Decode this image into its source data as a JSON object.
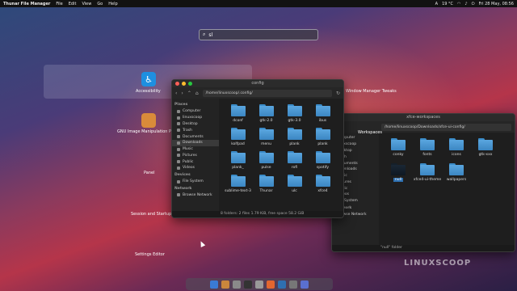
{
  "topbar": {
    "app": "Thunar File Manager",
    "menu": [
      "File",
      "Edit",
      "View",
      "Go",
      "Help"
    ],
    "status": [
      "A",
      "19 °C",
      "Fri 28 May, 08:56"
    ]
  },
  "search": {
    "value": "sl",
    "icon": "search-icon"
  },
  "launcher": {
    "items": [
      "Accessibility",
      "Window Manager Tweaks",
      "GNU Image Manipulation Program",
      "Panel",
      "Session and Startup",
      "Settings Editor"
    ]
  },
  "win1": {
    "title": "config",
    "path": "/home/linuxscoop/.config/",
    "sidebar": {
      "places_title": "Places",
      "places": [
        "Computer",
        "linuxscoop",
        "Desktop",
        "Trash",
        "Documents",
        "Downloads",
        "Music",
        "Pictures",
        "Public",
        "Videos"
      ],
      "devices_title": "Devices",
      "devices": [
        "File System"
      ],
      "network_title": "Network",
      "network": [
        "Browse Network"
      ]
    },
    "folders": [
      "dconf",
      "gtk-2.0",
      "gtk-3.0",
      "ibus",
      "kolfpad",
      "menu",
      "plank",
      "plank",
      "plank_",
      "pulse",
      "rofi",
      "spotify",
      "sublime-text-3",
      "Thunar",
      "ulc",
      "xfce4"
    ],
    "status": "8 folders: 2 files 1.79 KiB, free space 58.2 GiB"
  },
  "win2": {
    "title": "xfce-workspaces",
    "path": "/home/linuxscoop/Downloads/xfce-ui-config/",
    "sidebar": [
      "Computer",
      "linuxscoop",
      "Desktop",
      "Trash",
      "Documents",
      "Downloads",
      "Music",
      "Pictures",
      "Public",
      "Videos"
    ],
    "devices": [
      "File System"
    ],
    "network_title": "Network",
    "network": [
      "Browse Network"
    ],
    "folders": [
      "conky",
      "fonts",
      "icons",
      "gtk-xxx",
      "null",
      "xfce4-ui-theme",
      "wallpapers"
    ],
    "status": "\"null\" folder"
  },
  "workspaces_label": "Workspaces",
  "watermark": "LINUXSCOOP",
  "dock": {
    "items": [
      "finder",
      "gimp",
      "files",
      "terminal",
      "settings",
      "firefox",
      "code",
      "trash",
      "menu"
    ]
  }
}
